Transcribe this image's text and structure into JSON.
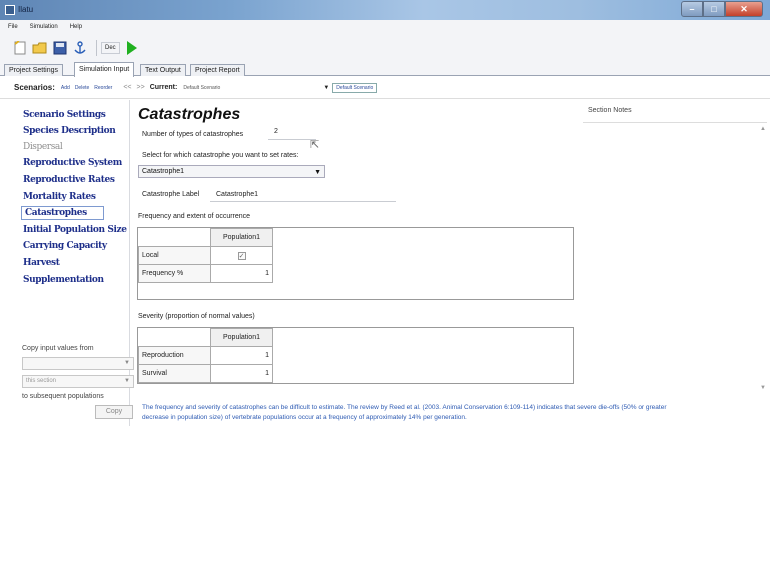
{
  "window": {
    "title": "Ilatu"
  },
  "menu": [
    "File",
    "Simulation",
    "Help"
  ],
  "toolbar": {
    "text_button": "Dec",
    "icons": [
      "new-icon",
      "open-icon",
      "save-icon",
      "anchor-icon",
      "run-icon"
    ]
  },
  "tabs": [
    {
      "label": "Project Settings",
      "active": false
    },
    {
      "label": "Simulation Input",
      "active": true
    },
    {
      "label": "Text Output",
      "active": false
    },
    {
      "label": "Project Report",
      "active": false
    }
  ],
  "scenarios": {
    "label": "Scenarios:",
    "add": "Add",
    "delete": "Delete",
    "reorder": "Reorder",
    "prev": "<<",
    "next": ">>",
    "current_label": "Current:",
    "current_value": "Default Scenario",
    "selector": "Default Scenario"
  },
  "sidebar": {
    "items": [
      {
        "label": "Scenario Settings",
        "state": "normal"
      },
      {
        "label": "Species Description",
        "state": "normal"
      },
      {
        "label": "Dispersal",
        "state": "disabled"
      },
      {
        "label": "Reproductive System",
        "state": "normal"
      },
      {
        "label": "Reproductive Rates",
        "state": "normal"
      },
      {
        "label": "Mortality Rates",
        "state": "normal"
      },
      {
        "label": "Catastrophes",
        "state": "selected"
      },
      {
        "label": "Initial Population Size",
        "state": "normal"
      },
      {
        "label": "Carrying Capacity",
        "state": "normal"
      },
      {
        "label": "Harvest",
        "state": "normal"
      },
      {
        "label": "Supplementation",
        "state": "normal"
      }
    ],
    "copy_label": "Copy input values from",
    "copy_source": "",
    "copy_scope": "this section",
    "copy_target_label": "to subsequent populations",
    "copy_button": "Copy"
  },
  "main": {
    "title": "Catastrophes",
    "num_types_label": "Number of types of catastrophes",
    "num_types_value": "2",
    "select_label": "Select for which catastrophe you want to set rates:",
    "select_value": "Catastrophe1",
    "cat_label_label": "Catastrophe Label",
    "cat_label_value": "Catastrophe1",
    "freq_title": "Frequency and extent of occurrence",
    "freq_grid": {
      "column": "Population1",
      "rows": [
        {
          "label": "Local",
          "checked": true
        },
        {
          "label": "Frequency %",
          "value": "1"
        }
      ]
    },
    "sev_title": "Severity (proportion of normal values)",
    "sev_grid": {
      "column": "Population1",
      "rows": [
        {
          "label": "Reproduction",
          "value": "1"
        },
        {
          "label": "Survival",
          "value": "1"
        }
      ]
    },
    "note": "The frequency and severity of catastrophes can be difficult to estimate. The review by Reed et al. (2003. Animal Conservation 6:109-114) indicates that severe die-offs (50% or greater decrease in population size) of vertebrate populations occur at a frequency of approximately 14% per generation."
  },
  "notes_panel": {
    "title": "Section Notes"
  }
}
